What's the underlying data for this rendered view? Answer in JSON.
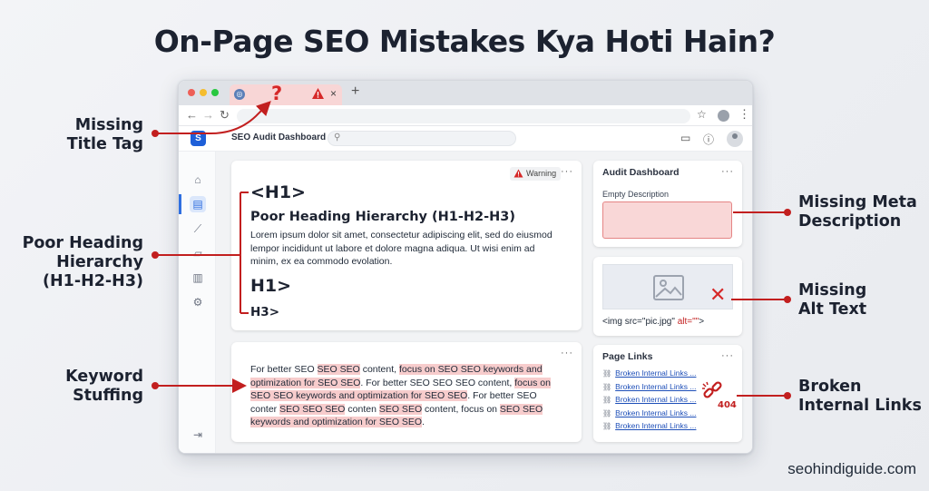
{
  "headline": "On-Page SEO Mistakes Kya Hoti Hain?",
  "brand": "seohindiguide.com",
  "callouts": {
    "missing_title": "Missing\nTitle Tag",
    "poor_heading": "Poor Heading\nHierarchy\n(H1-H2-H3)",
    "keyword_stuffing": "Keyword\nStuffing",
    "missing_meta": "Missing Meta\nDescription",
    "missing_alt": "Missing\nAlt Text",
    "broken_links": "Broken\nInternal Links"
  },
  "browser": {
    "tab_question": "?",
    "tab_close": "×",
    "new_tab": "+"
  },
  "app": {
    "logo": "S",
    "title": "SEO Audit Dashboard",
    "search_icon": "search-icon"
  },
  "heading_card": {
    "warning_label": "Warning",
    "menu": "···",
    "h1_top": "<H1>",
    "h2_text": "Poor Heading Hierarchy (H1-H2-H3)",
    "lorem": "Lorem ipsum dolor sit amet, consectetur adipiscing elit, sed do eiusmod lempor incididunt ut labore et dolore magna adiqua. Ut wisi enim ad minim, ex ea commodo evolation.",
    "h1_mid": "H1>",
    "h3": "H3>"
  },
  "keyword_card": {
    "menu": "···",
    "segments": [
      {
        "text": "For better SEO ",
        "hl": false
      },
      {
        "text": "SEO SEO",
        "hl": true
      },
      {
        "text": " content, ",
        "hl": false
      },
      {
        "text": "focus on SEO SEO keywords and optimization for SEO SEO",
        "hl": true
      },
      {
        "text": ". For better SEO SEO SEO content, ",
        "hl": false
      },
      {
        "text": "focus on SEO SEO keywords and optimization for SEO SEO",
        "hl": true
      },
      {
        "text": ". For better SEO conter ",
        "hl": false
      },
      {
        "text": "SEO SEO SEO",
        "hl": true
      },
      {
        "text": " conten ",
        "hl": false
      },
      {
        "text": "SEO SEO",
        "hl": true
      },
      {
        "text": " content, focus on ",
        "hl": false
      },
      {
        "text": "SEO SEO keywords and optimization for SEO SEO",
        "hl": true
      },
      {
        "text": ".",
        "hl": false
      }
    ]
  },
  "audit_card": {
    "title": "Audit Dashboard",
    "menu": "···",
    "empty_label": "Empty Description"
  },
  "image_card": {
    "x_mark": "✕",
    "code_prefix": "<img src=\"pic.jpg\" ",
    "code_alt": "alt=\"\"",
    "code_suffix": ">"
  },
  "links_card": {
    "title": "Page Links",
    "menu": "···",
    "links": [
      "Broken Internal Links ...",
      "Broken Internal Links ...",
      "Broken Internal Links ...",
      "Broken Internal Links ...",
      "Broken Internal Links ..."
    ],
    "code_404": "404"
  },
  "colors": {
    "accent_red": "#d62828",
    "highlight": "#f7cccc",
    "brand_blue": "#1e5fd8"
  }
}
